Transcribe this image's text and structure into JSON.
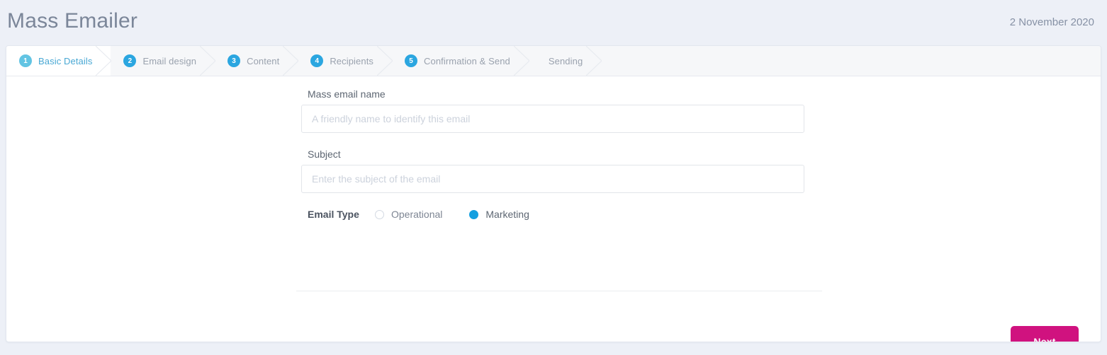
{
  "header": {
    "title": "Mass Emailer",
    "date": "2 November 2020"
  },
  "wizard": {
    "steps": [
      {
        "num": "1",
        "label": "Basic Details",
        "active": true
      },
      {
        "num": "2",
        "label": "Email design",
        "active": false
      },
      {
        "num": "3",
        "label": "Content",
        "active": false
      },
      {
        "num": "4",
        "label": "Recipients",
        "active": false
      },
      {
        "num": "5",
        "label": "Confirmation & Send",
        "active": false
      },
      {
        "num": "",
        "label": "Sending",
        "active": false
      }
    ]
  },
  "form": {
    "name_field": {
      "label": "Mass email name",
      "placeholder": "A friendly name to identify this email",
      "value": ""
    },
    "subject_field": {
      "label": "Subject",
      "placeholder": "Enter the subject of the email",
      "value": ""
    },
    "email_type": {
      "label": "Email Type",
      "options": [
        {
          "label": "Operational",
          "selected": false
        },
        {
          "label": "Marketing",
          "selected": true
        }
      ]
    }
  },
  "actions": {
    "next_label": "Next"
  },
  "colors": {
    "page_background": "#edf0f7",
    "accent_blue": "#2ba6e0",
    "active_step_blue": "#62c4e3",
    "radio_selected": "#139fe0",
    "next_button": "#d0127f",
    "title_gray": "#7b8699"
  }
}
